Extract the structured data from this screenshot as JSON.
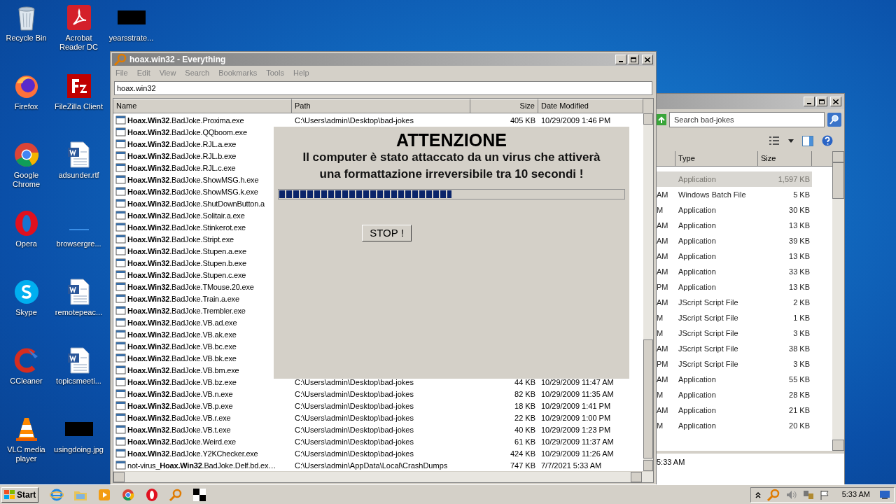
{
  "desktop_icons": [
    {
      "kind": "recycle",
      "label": "Recycle Bin"
    },
    {
      "kind": "firefox",
      "label": "Firefox"
    },
    {
      "kind": "chrome",
      "label": "Google Chrome"
    },
    {
      "kind": "opera",
      "label": "Opera"
    },
    {
      "kind": "skype",
      "label": "Skype"
    },
    {
      "kind": "ccleaner",
      "label": "CCleaner"
    },
    {
      "kind": "vlc",
      "label": "VLC media player"
    },
    {
      "kind": "pdf",
      "label": "Acrobat Reader DC"
    },
    {
      "kind": "filezilla",
      "label": "FileZilla Client"
    },
    {
      "kind": "word",
      "label": "adsunder.rtf"
    },
    {
      "kind": "blank",
      "label": "browsergre..."
    },
    {
      "kind": "word",
      "label": "remotepeac..."
    },
    {
      "kind": "word",
      "label": "topicsmeeti..."
    },
    {
      "kind": "black",
      "label": "usingdoing.jpg"
    },
    {
      "kind": "black",
      "label": "yearsstrate..."
    }
  ],
  "everything": {
    "title": "hoax.win32 - Everything",
    "menu": [
      "File",
      "Edit",
      "View",
      "Search",
      "Bookmarks",
      "Tools",
      "Help"
    ],
    "search_value": "hoax.win32",
    "columns": [
      "Name",
      "Path",
      "Size",
      "Date Modified"
    ],
    "rows": [
      {
        "name": "**Hoax.Win32**.BadJoke.Proxima.exe",
        "path": "C:\\Users\\admin\\Desktop\\bad-jokes",
        "size": "405 KB",
        "date": "10/29/2009 1:46 PM"
      },
      {
        "name": "**Hoax.Win32**.BadJoke.QQboom.exe"
      },
      {
        "name": "**Hoax.Win32**.BadJoke.RJL.a.exe"
      },
      {
        "name": "**Hoax.Win32**.BadJoke.RJL.b.exe"
      },
      {
        "name": "**Hoax.Win32**.BadJoke.RJL.c.exe"
      },
      {
        "name": "**Hoax.Win32**.BadJoke.ShowMSG.h.exe"
      },
      {
        "name": "**Hoax.Win32**.BadJoke.ShowMSG.k.exe"
      },
      {
        "name": "**Hoax.Win32**.BadJoke.ShutDownButton.a"
      },
      {
        "name": "**Hoax.Win32**.BadJoke.Solitair.a.exe"
      },
      {
        "name": "**Hoax.Win32**.BadJoke.Stinkerot.exe"
      },
      {
        "name": "**Hoax.Win32**.BadJoke.Stript.exe"
      },
      {
        "name": "**Hoax.Win32**.BadJoke.Stupen.a.exe"
      },
      {
        "name": "**Hoax.Win32**.BadJoke.Stupen.b.exe"
      },
      {
        "name": "**Hoax.Win32**.BadJoke.Stupen.c.exe"
      },
      {
        "name": "**Hoax.Win32**.BadJoke.TMouse.20.exe"
      },
      {
        "name": "**Hoax.Win32**.BadJoke.Train.a.exe"
      },
      {
        "name": "**Hoax.Win32**.BadJoke.Trembler.exe"
      },
      {
        "name": "**Hoax.Win32**.BadJoke.VB.ad.exe"
      },
      {
        "name": "**Hoax.Win32**.BadJoke.VB.ak.exe"
      },
      {
        "name": "**Hoax.Win32**.BadJoke.VB.bc.exe"
      },
      {
        "name": "**Hoax.Win32**.BadJoke.VB.bk.exe"
      },
      {
        "name": "**Hoax.Win32**.BadJoke.VB.bm.exe"
      },
      {
        "name": "**Hoax.Win32**.BadJoke.VB.bz.exe",
        "path": "C:\\Users\\admin\\Desktop\\bad-jokes",
        "size": "44 KB",
        "date": "10/29/2009 11:47 AM"
      },
      {
        "name": "**Hoax.Win32**.BadJoke.VB.n.exe",
        "path": "C:\\Users\\admin\\Desktop\\bad-jokes",
        "size": "82 KB",
        "date": "10/29/2009 11:35 AM"
      },
      {
        "name": "**Hoax.Win32**.BadJoke.VB.p.exe",
        "path": "C:\\Users\\admin\\Desktop\\bad-jokes",
        "size": "18 KB",
        "date": "10/29/2009 1:41 PM"
      },
      {
        "name": "**Hoax.Win32**.BadJoke.VB.r.exe",
        "path": "C:\\Users\\admin\\Desktop\\bad-jokes",
        "size": "22 KB",
        "date": "10/29/2009 1:00 PM"
      },
      {
        "name": "**Hoax.Win32**.BadJoke.VB.t.exe",
        "path": "C:\\Users\\admin\\Desktop\\bad-jokes",
        "size": "40 KB",
        "date": "10/29/2009 1:23 PM"
      },
      {
        "name": "**Hoax.Win32**.BadJoke.Weird.exe",
        "path": "C:\\Users\\admin\\Desktop\\bad-jokes",
        "size": "61 KB",
        "date": "10/29/2009 11:37 AM"
      },
      {
        "name": "**Hoax.Win32**.BadJoke.Y2KChecker.exe",
        "path": "C:\\Users\\admin\\Desktop\\bad-jokes",
        "size": "424 KB",
        "date": "10/29/2009 11:26 AM"
      },
      {
        "name": "not-virus_**Hoax.Win32**.BadJoke.Delf.bd.ex…",
        "path": "C:\\Users\\admin\\AppData\\Local\\CrashDumps",
        "size": "747 KB",
        "date": "7/7/2021 5:33 AM"
      }
    ]
  },
  "alert": {
    "title": "ATTENZIONE",
    "message_lines": [
      "Il computer è stato attaccato da un virus che attiverà",
      "una formattazione irreversibile tra 10 secondi !"
    ],
    "progress": {
      "level": 0.5
    },
    "button": "STOP !"
  },
  "explorer": {
    "search_placeholder": "Search bad-jokes",
    "columns": [
      "Type",
      "Size"
    ],
    "rows": [
      {
        "date_tail": "",
        "type": "Application",
        "size": "1,597 KB",
        "selected": true
      },
      {
        "date_tail": "AM",
        "type": "Windows Batch File",
        "size": "5 KB",
        "selected": false
      },
      {
        "date_tail": "M",
        "type": "Application",
        "size": "30 KB",
        "selected": false
      },
      {
        "date_tail": "AM",
        "type": "Application",
        "size": "13 KB",
        "selected": false
      },
      {
        "date_tail": "AM",
        "type": "Application",
        "size": "39 KB",
        "selected": false
      },
      {
        "date_tail": "AM",
        "type": "Application",
        "size": "13 KB",
        "selected": false
      },
      {
        "date_tail": "AM",
        "type": "Application",
        "size": "33 KB",
        "selected": false
      },
      {
        "date_tail": "PM",
        "type": "Application",
        "size": "13 KB",
        "selected": false
      },
      {
        "date_tail": "AM",
        "type": "JScript Script File",
        "size": "2 KB",
        "selected": false
      },
      {
        "date_tail": "M",
        "type": "JScript Script File",
        "size": "1 KB",
        "selected": false
      },
      {
        "date_tail": "M",
        "type": "JScript Script File",
        "size": "3 KB",
        "selected": false
      },
      {
        "date_tail": "AM",
        "type": "JScript Script File",
        "size": "38 KB",
        "selected": false
      },
      {
        "date_tail": "PM",
        "type": "JScript Script File",
        "size": "3 KB",
        "selected": false
      },
      {
        "date_tail": "AM",
        "type": "Application",
        "size": "55 KB",
        "selected": false
      },
      {
        "date_tail": "M",
        "type": "Application",
        "size": "28 KB",
        "selected": false
      },
      {
        "date_tail": "AM",
        "type": "Application",
        "size": "21 KB",
        "selected": false
      },
      {
        "date_tail": "M",
        "type": "Application",
        "size": "20 KB",
        "selected": false
      }
    ],
    "details_time": "5:33 AM"
  },
  "taskbar": {
    "start": "Start",
    "apps": [
      {
        "kind": "ie"
      },
      {
        "kind": "folder"
      },
      {
        "kind": "media"
      },
      {
        "kind": "chrome"
      },
      {
        "kind": "opera"
      },
      {
        "kind": "search"
      },
      {
        "kind": "checker"
      }
    ],
    "clock": "5:33 AM"
  }
}
